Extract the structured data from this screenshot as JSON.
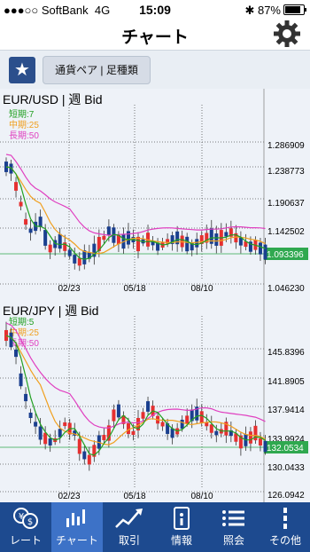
{
  "status": {
    "carrier": "●●●○○ SoftBank",
    "network": "4G",
    "time": "15:09",
    "battery": "87%"
  },
  "nav": {
    "title": "チャート"
  },
  "toolbar": {
    "pair_button": "通貨ペア | 足種類"
  },
  "charts": [
    {
      "title": "EUR/USD | 週 Bid",
      "legend": [
        {
          "label": "短期:7",
          "color": "#22a022"
        },
        {
          "label": "中期:25",
          "color": "#f0a020"
        },
        {
          "label": "長期:50",
          "color": "#e040c0"
        }
      ],
      "price_labels": [
        "1.286909",
        "1.238773",
        "1.190637",
        "1.142502",
        "1.046230"
      ],
      "current_price": "1.093396",
      "date_labels": [
        "02/23",
        "05/18",
        "08/10"
      ]
    },
    {
      "title": "EUR/JPY | 週 Bid",
      "legend": [
        {
          "label": "短期:5",
          "color": "#22a022"
        },
        {
          "label": "中期:25",
          "color": "#f0a020"
        },
        {
          "label": "長期:50",
          "color": "#e040c0"
        }
      ],
      "price_labels": [
        "145.8396",
        "141.8905",
        "137.9414",
        "133.9924",
        "130.0433",
        "126.0942"
      ],
      "current_price": "132.0534",
      "date_labels": [
        "02/23",
        "05/18",
        "08/10"
      ]
    }
  ],
  "tabs": [
    {
      "label": "レート",
      "icon": "rate-icon"
    },
    {
      "label": "チャート",
      "icon": "chart-icon"
    },
    {
      "label": "取引",
      "icon": "trade-icon"
    },
    {
      "label": "情報",
      "icon": "info-icon"
    },
    {
      "label": "照会",
      "icon": "list-icon"
    },
    {
      "label": "その他",
      "icon": "more-icon"
    }
  ],
  "colors": {
    "up": "#e53030",
    "down": "#1a3f8f",
    "tab_bg": "#1d4a8f",
    "tab_active": "#3d72c7",
    "current_tag": "#2fa84f"
  }
}
